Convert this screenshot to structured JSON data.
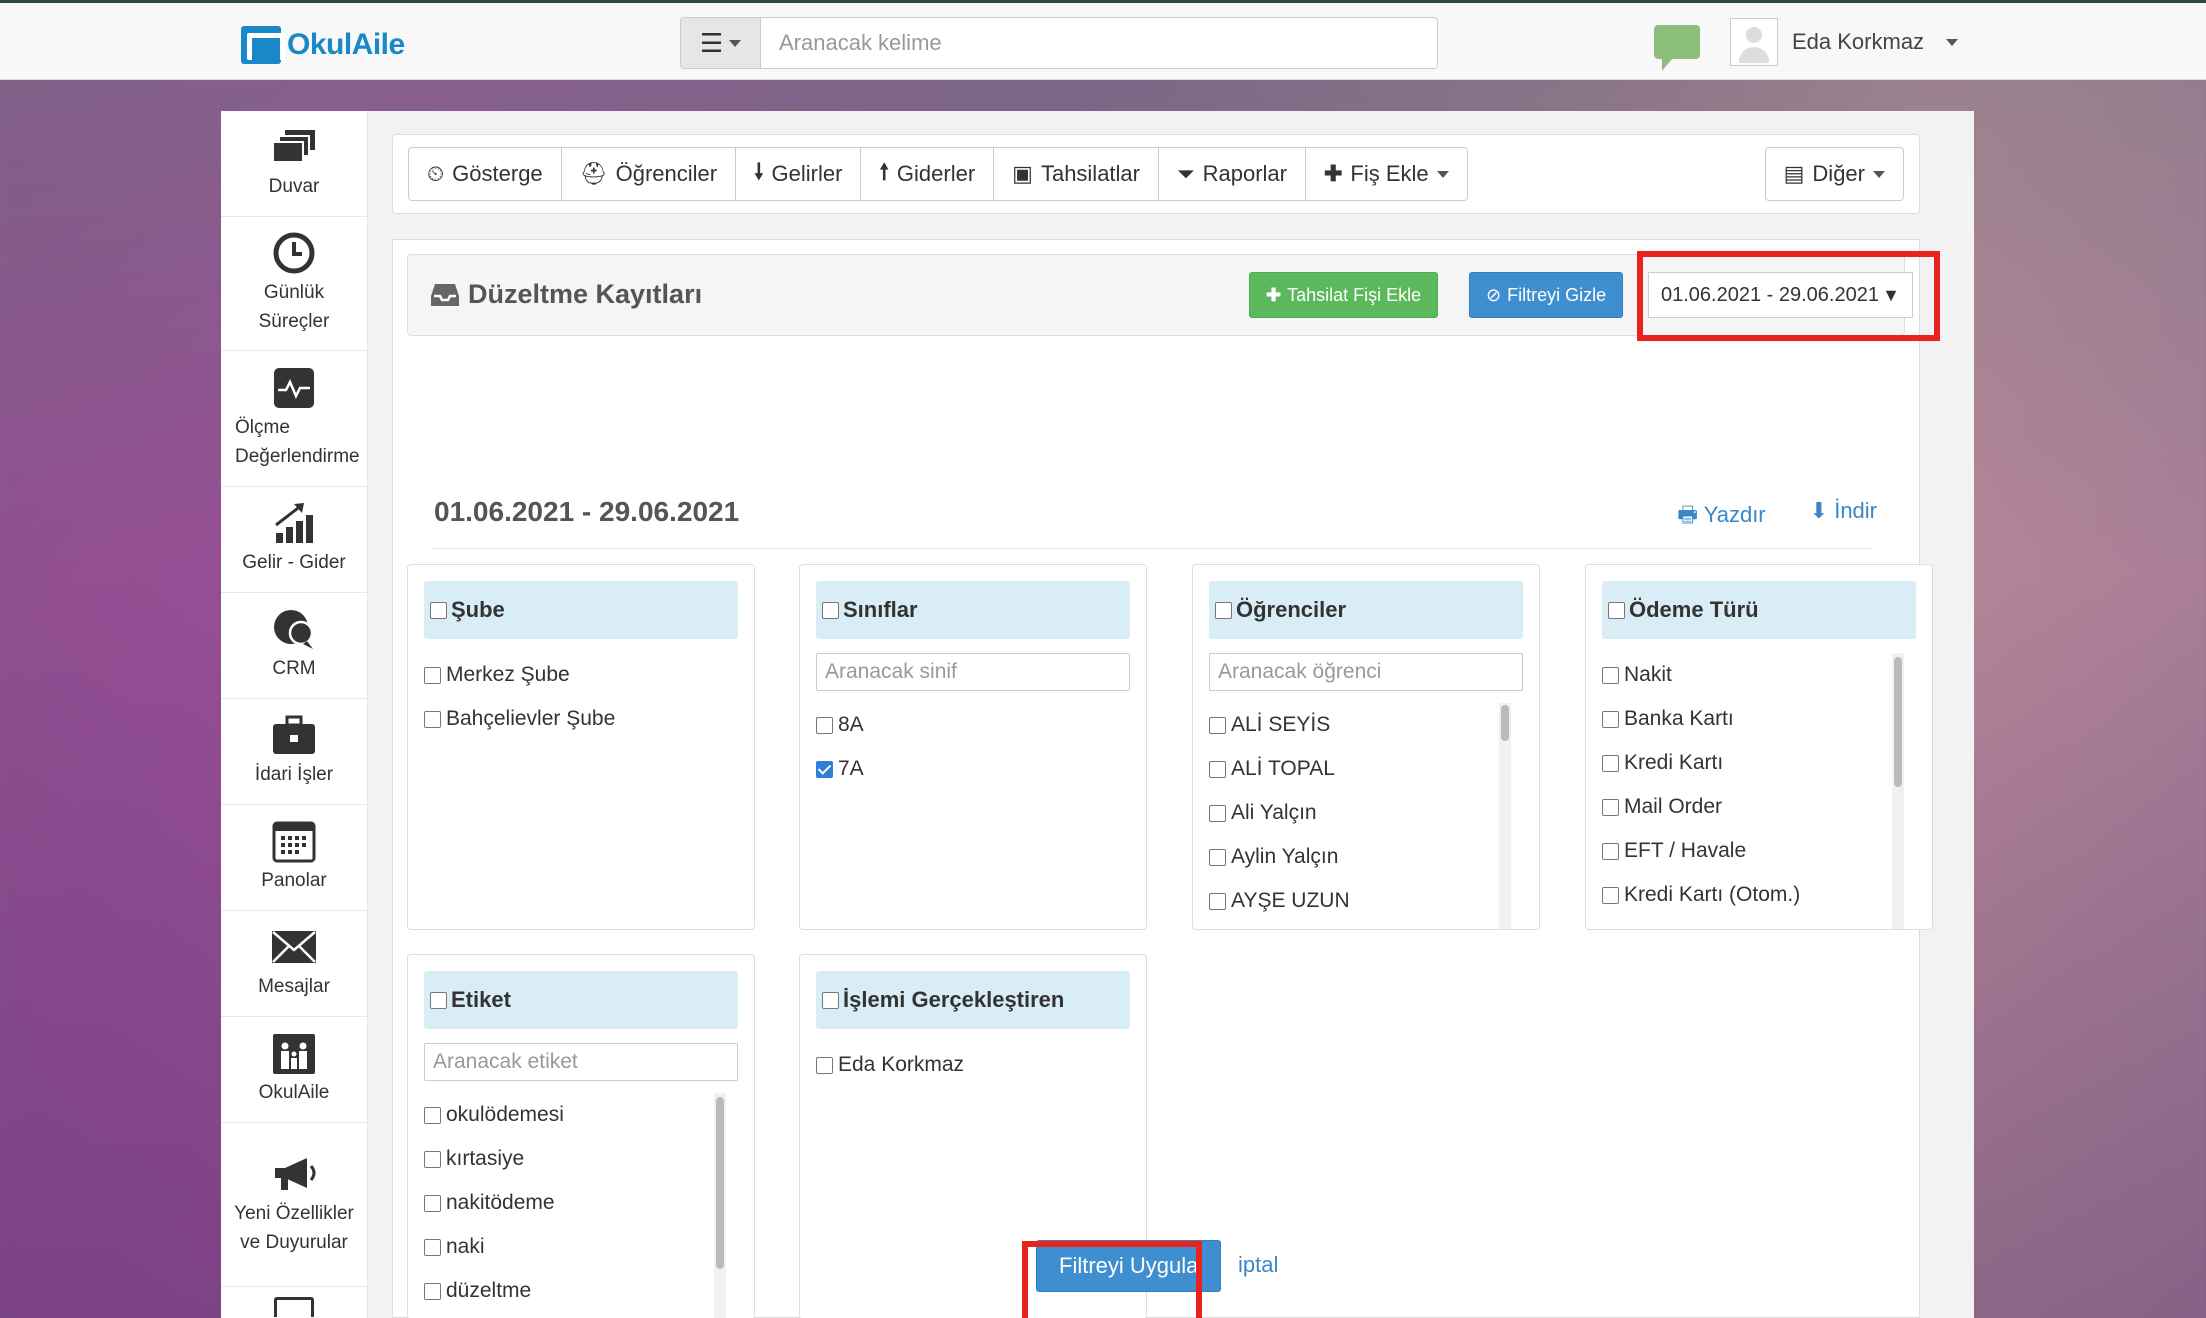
{
  "app": {
    "logo_text": "OkulAile"
  },
  "header": {
    "search_placeholder": "Aranacak kelime",
    "user_name": "Eda Korkmaz"
  },
  "sidebar": {
    "items": [
      {
        "label": "Duvar",
        "icon": "layers-icon"
      },
      {
        "label": "Günlük Süreçler",
        "icon": "clock-icon"
      },
      {
        "label": "Ölçme Değerlendirme",
        "icon": "pulse-monitor-icon"
      },
      {
        "label": "Gelir - Gider",
        "icon": "bar-growth-icon"
      },
      {
        "label": "CRM",
        "icon": "crm-chat-icon"
      },
      {
        "label": "İdari İşler",
        "icon": "briefcase-icon"
      },
      {
        "label": "Panolar",
        "icon": "calendar-board-icon"
      },
      {
        "label": "Mesajlar",
        "icon": "envelope-icon"
      },
      {
        "label": "OkulAile",
        "icon": "family-icon"
      },
      {
        "label": "Yeni Özellikler ve Duyurular",
        "icon": "megaphone-icon"
      }
    ]
  },
  "toolbar": {
    "buttons": [
      {
        "label": "Gösterge",
        "icon": "dashboard-icon"
      },
      {
        "label": "Öğrenciler",
        "icon": "students-icon"
      },
      {
        "label": "Gelirler",
        "icon": "arrow-down-icon"
      },
      {
        "label": "Giderler",
        "icon": "arrow-up-icon"
      },
      {
        "label": "Tahsilatlar",
        "icon": "inbox-icon"
      },
      {
        "label": "Raporlar",
        "icon": "filter-icon"
      },
      {
        "label": "Fiş Ekle",
        "icon": "plus-icon"
      }
    ],
    "other_label": "Diğer"
  },
  "panel": {
    "title": "Düzeltme Kayıtları",
    "add_receipt_label": "Tahsilat Fişi Ekle",
    "hide_filter_label": "Filtreyi Gizle",
    "date_range_value": "01.06.2021 - 29.06.2021",
    "range_heading": "01.06.2021 - 29.06.2021",
    "print_label": "Yazdır",
    "download_label": "İndir"
  },
  "filters": {
    "sube": {
      "title": "Şube",
      "items": [
        "Merkez Şube",
        "Bahçelievler Şube"
      ]
    },
    "siniflar": {
      "title": "Sınıflar",
      "search_placeholder": "Aranacak sinif",
      "items": [
        "8A",
        "7A"
      ],
      "checked": [
        false,
        true
      ]
    },
    "ogrenciler": {
      "title": "Öğrenciler",
      "search_placeholder": "Aranacak öğrenci",
      "items": [
        "ALİ SEYİS",
        "ALİ TOPAL",
        "Ali Yalçın",
        "Aylin Yalçın",
        "AYŞE UZUN"
      ]
    },
    "odeme": {
      "title": "Ödeme Türü",
      "items": [
        "Nakit",
        "Banka Kartı",
        "Kredi Kartı",
        "Mail Order",
        "EFT / Havale",
        "Kredi Kartı (Otom.)"
      ]
    },
    "etiket": {
      "title": "Etiket",
      "search_placeholder": "Aranacak etiket",
      "items": [
        "okulödemesi",
        "kırtasiye",
        "nakitödeme",
        "naki",
        "düzeltme"
      ]
    },
    "islem": {
      "title": "İşlemi Gerçekleştiren",
      "items": [
        "Eda Korkmaz"
      ]
    }
  },
  "actions": {
    "apply_label": "Filtreyi Uygula",
    "cancel_label": "iptal"
  },
  "colors": {
    "brand": "#1a88c8",
    "primary": "#3e8ed0",
    "success": "#5cb85c",
    "highlight": "#e8221c",
    "filter_header": "#d9edf7"
  }
}
